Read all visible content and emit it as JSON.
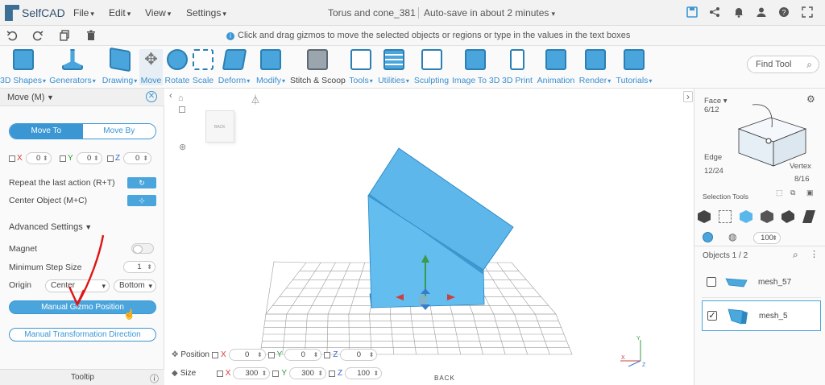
{
  "app": {
    "name": "SelfCAD",
    "doc_title": "Torus and cone_381",
    "autosave": "Auto-save in about 2 minutes"
  },
  "menus": [
    "File",
    "Edit",
    "View",
    "Settings"
  ],
  "hint": "Click and drag gizmos to move the selected objects or regions or type in the values in the text boxes",
  "tools": [
    {
      "label": "3D Shapes"
    },
    {
      "label": "Generators"
    },
    {
      "label": "Drawing"
    },
    {
      "label": "Move"
    },
    {
      "label": "Rotate"
    },
    {
      "label": "Scale"
    },
    {
      "label": "Deform"
    },
    {
      "label": "Modify"
    },
    {
      "label": "Stitch & Scoop"
    },
    {
      "label": "Tools"
    },
    {
      "label": "Utilities"
    },
    {
      "label": "Sculpting"
    },
    {
      "label": "Image To 3D"
    },
    {
      "label": "3D Print"
    },
    {
      "label": "Animation"
    },
    {
      "label": "Render"
    },
    {
      "label": "Tutorials"
    }
  ],
  "find_tool": "Find Tool",
  "left": {
    "title": "Move (M)",
    "seg_on": "Move To",
    "seg_off": "Move By",
    "x_label": "X",
    "y_label": "Y",
    "z_label": "Z",
    "x": "0",
    "y": "0",
    "z": "0",
    "repeat": "Repeat the last action (R+T)",
    "center": "Center Object (M+C)",
    "advanced": "Advanced Settings",
    "magnet": "Magnet",
    "min_step": "Minimum Step Size",
    "min_step_val": "1",
    "origin": "Origin",
    "origin_a": "Center",
    "origin_b": "Bottom",
    "manual_gizmo": "Manual Gizmo Position",
    "manual_transform": "Manual Transformation Direction",
    "tooltip": "Tooltip"
  },
  "viewport": {
    "cube_label": "BACK",
    "ground_label": "BACK",
    "pos_label": "Position",
    "size_label": "Size",
    "pos": [
      "0",
      "0",
      "0"
    ],
    "size": [
      "300",
      "300",
      "100"
    ],
    "axis_x": "X",
    "axis_y": "Y",
    "axis_z": "Z"
  },
  "right": {
    "face": "Face",
    "face_count": "6/12",
    "edge": "Edge",
    "edge_count": "12/24",
    "vertex": "Vertex",
    "vertex_count": "8/16",
    "selection_tools": "Selection Tools",
    "percent": "100",
    "objects": "Objects 1 / 2",
    "items": [
      {
        "name": "mesh_57",
        "checked": false
      },
      {
        "name": "mesh_5",
        "checked": true
      }
    ]
  },
  "colors": {
    "accent": "#3a97d4",
    "shape": "#5bb9ec",
    "shape_edge": "#2a86c2"
  }
}
